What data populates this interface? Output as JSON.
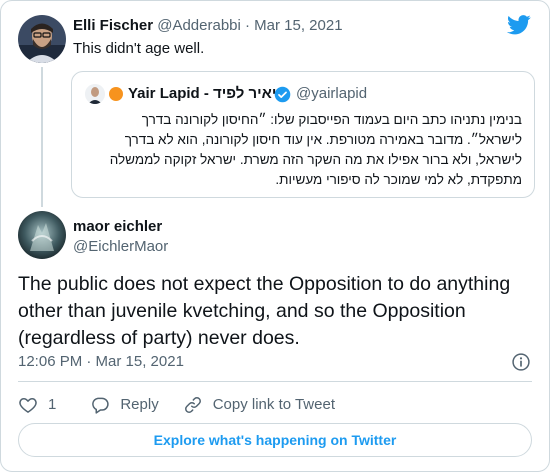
{
  "brand": {
    "icon": "twitter-bird-icon",
    "color": "#1d9bf0"
  },
  "parent_tweet": {
    "author_name": "Elli Fischer",
    "meta": "@Adderabbi · Mar 15, 2021",
    "text": "This didn't age well."
  },
  "quoted_tweet": {
    "author_name": "Yair Lapid - יאיר לפיד",
    "handle": "@yairlapid",
    "verified": true,
    "text": "בנימין נתניהו כתב היום בעמוד הפייסבוק שלו: ״החיסון לקורונה בדרך לישראל״. מדובר באמירה מטורפת. אין עוד חיסון לקורונה, הוא לא בדרך לישראל, ולא ברור אפילו את מה השקר הזה משרת. ישראל זקוקה לממשלה מתפקדת, לא למי שמוכר לה סיפורי מעשיות."
  },
  "main_tweet": {
    "author_name": "maor eichler",
    "handle": "@EichlerMaor",
    "text": "The public does not expect the Opposition to do anything other than juvenile kvetching, and so the Opposition (regardless of party) never does.",
    "timestamp": "12:06 PM · Mar 15, 2021"
  },
  "actions": {
    "like_count": "1",
    "reply_label": "Reply",
    "copy_link_label": "Copy link to Tweet"
  },
  "footer": {
    "explore_label": "Explore what's happening on Twitter"
  },
  "colors": {
    "text": "#0f1419",
    "muted": "#536471",
    "border": "#cfd9de",
    "accent": "#1d9bf0",
    "lapid_flag": "#f7931e"
  }
}
